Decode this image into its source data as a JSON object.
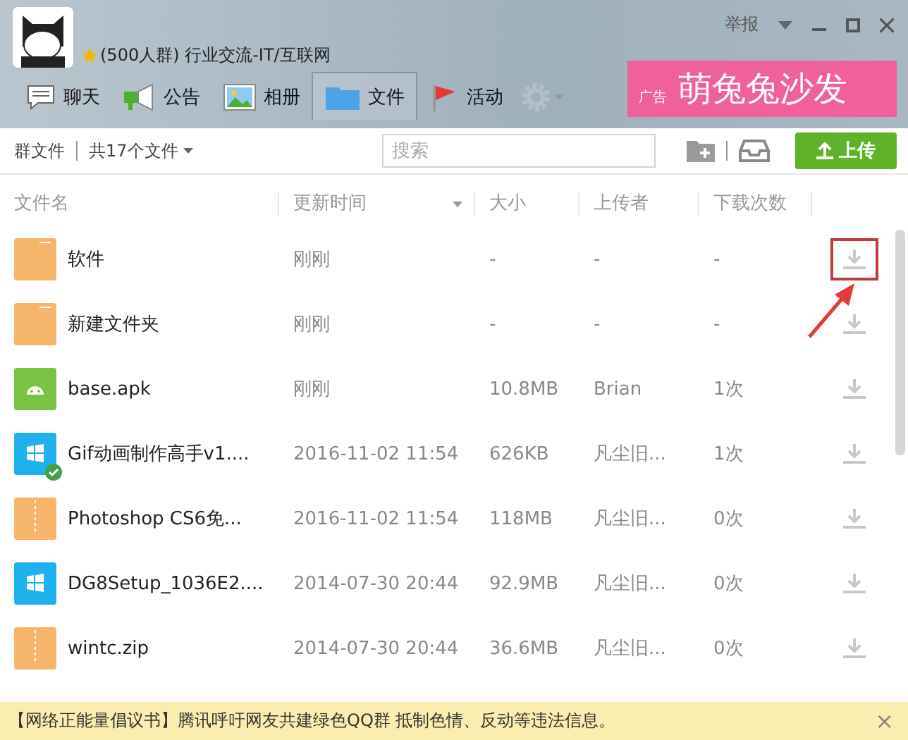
{
  "window": {
    "group_name": "(500人群) 行业交流-IT/互联网",
    "report": "举报"
  },
  "tabs": [
    {
      "label": "聊天",
      "selected": false
    },
    {
      "label": "公告",
      "selected": false
    },
    {
      "label": "相册",
      "selected": false
    },
    {
      "label": "文件",
      "selected": true
    },
    {
      "label": "活动",
      "selected": false
    }
  ],
  "ad": {
    "tag": "广告",
    "text": "萌兔兔沙发"
  },
  "toolbar": {
    "scope": "群文件",
    "count": "共17个文件",
    "search": {
      "placeholder": "搜索"
    },
    "upload": "上传"
  },
  "table": {
    "columns": [
      "文件名",
      "更新时间",
      "大小",
      "上传者",
      "下载次数"
    ],
    "rows": [
      {
        "kind": "folder",
        "name": "软件",
        "time": "刚刚",
        "size": "-",
        "uploader": "-",
        "downloads": "-",
        "downloaded": false,
        "highlighted": true
      },
      {
        "kind": "folder",
        "name": "新建文件夹",
        "time": "刚刚",
        "size": "-",
        "uploader": "-",
        "downloads": "-",
        "downloaded": false,
        "highlighted": false
      },
      {
        "kind": "apk",
        "name": "base.apk",
        "time": "刚刚",
        "size": "10.8MB",
        "uploader": "Brian",
        "downloads": "1次",
        "downloaded": false,
        "highlighted": false
      },
      {
        "kind": "exe",
        "name": "Gif动画制作高手v1....",
        "time": "2016-11-02 11:54",
        "size": "626KB",
        "uploader": "凡尘旧...",
        "downloads": "1次",
        "downloaded": true,
        "highlighted": false
      },
      {
        "kind": "zip",
        "name": "Photoshop CS6免...",
        "time": "2016-11-02 11:54",
        "size": "118MB",
        "uploader": "凡尘旧...",
        "downloads": "0次",
        "downloaded": false,
        "highlighted": false
      },
      {
        "kind": "exe",
        "name": "DG8Setup_1036E2....",
        "time": "2014-07-30 20:44",
        "size": "92.9MB",
        "uploader": "凡尘旧...",
        "downloads": "0次",
        "downloaded": false,
        "highlighted": false
      },
      {
        "kind": "zip",
        "name": "wintc.zip",
        "time": "2014-07-30 20:44",
        "size": "36.6MB",
        "uploader": "凡尘旧...",
        "downloads": "0次",
        "downloaded": false,
        "highlighted": false
      }
    ]
  },
  "notice": {
    "text": "【网络正能量倡议书】腾讯呼吁网友共建绿色QQ群 抵制色情、反动等违法信息。",
    "close": "×"
  }
}
